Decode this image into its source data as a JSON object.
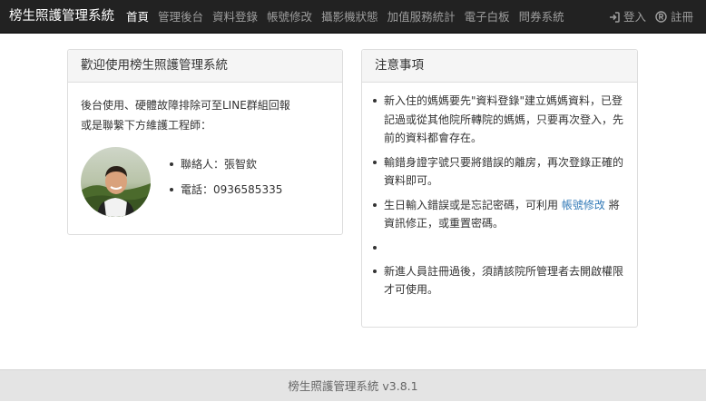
{
  "navbar": {
    "brand": "榜生照護管理系統",
    "items": [
      "首頁",
      "管理後台",
      "資料登錄",
      "帳號修改",
      "攝影機狀態",
      "加值服務統計",
      "電子白板",
      "問券系統"
    ],
    "login": "登入",
    "register": "註冊",
    "login_icon": "sign-in-icon",
    "register_icon": "registered-icon"
  },
  "welcome": {
    "title": "歡迎使用榜生照護管理系統",
    "line1": "後台使用、硬體故障排除可至LINE群組回報",
    "line2": "或是聯繫下方維護工程師：",
    "contact_name": "聯絡人：張智欽",
    "contact_phone": "電話：0936585335"
  },
  "notice": {
    "title": "注意事項",
    "item1": "新入住的媽媽要先\"資料登錄\"建立媽媽資料，已登記過或從其他院所轉院的媽媽，只要再次登入，先前的資料都會存在。",
    "item2": "輸錯身證字號只要將錯誤的離房，再次登錄正確的資料即可。",
    "item3_pre": "生日輸入錯誤或是忘記密碼，可利用",
    "item3_link": "帳號修改",
    "item3_post": "將資訊修正，或重置密碼。",
    "item4": "",
    "item5": "新進人員註冊過後，須請該院所管理者去開啟權限才可使用。"
  },
  "footer": {
    "text": "榜生照護管理系統 v3.8.1"
  },
  "colors": {
    "navbar_bg": "#222222",
    "link": "#337ab7",
    "footer_bg": "#e4e4e4"
  }
}
